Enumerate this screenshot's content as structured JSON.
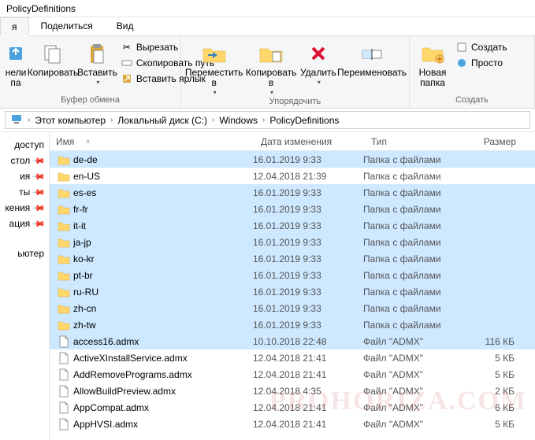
{
  "title": "PolicyDefinitions",
  "tabs": {
    "home": "я",
    "share": "Поделиться",
    "view": "Вид"
  },
  "ribbon": {
    "pin_label": "нели\nпа",
    "copy": "Копировать",
    "paste": "Вставить",
    "cut": "Вырезать",
    "copypath": "Скопировать путь",
    "pastelnk": "Вставить ярлык",
    "clipboard_group": "Буфер обмена",
    "moveto": "Переместить\nв",
    "copyto": "Копировать\nв",
    "delete": "Удалить",
    "rename": "Переименовать",
    "organize_group": "Упорядочить",
    "newfolder": "Новая\nпапка",
    "create": "Создать",
    "create_group": "Создать",
    "simple": "Просто"
  },
  "breadcrumbs": [
    "Этот компьютер",
    "Локальный диск (C:)",
    "Windows",
    "PolicyDefinitions"
  ],
  "sidebar": {
    "access": "доступ",
    "items": [
      "стол",
      "ия",
      "ты",
      "кения",
      "ация"
    ],
    "computer": "ьютер"
  },
  "columns": {
    "name": "Имя",
    "date": "Дата изменения",
    "type": "Тип",
    "size": "Размер"
  },
  "type_folder": "Папка с файлами",
  "type_admx": "Файл \"ADMX\"",
  "rows": [
    {
      "n": "de-de",
      "d": "16.01.2019 9:33",
      "t": "folder",
      "s": "",
      "sel": true
    },
    {
      "n": "en-US",
      "d": "12.04.2018 21:39",
      "t": "folder",
      "s": "",
      "sel": false
    },
    {
      "n": "es-es",
      "d": "16.01.2019 9:33",
      "t": "folder",
      "s": "",
      "sel": true
    },
    {
      "n": "fr-fr",
      "d": "16.01.2019 9:33",
      "t": "folder",
      "s": "",
      "sel": true
    },
    {
      "n": "it-it",
      "d": "16.01.2019 9:33",
      "t": "folder",
      "s": "",
      "sel": true
    },
    {
      "n": "ja-jp",
      "d": "16.01.2019 9:33",
      "t": "folder",
      "s": "",
      "sel": true
    },
    {
      "n": "ko-kr",
      "d": "16.01.2019 9:33",
      "t": "folder",
      "s": "",
      "sel": true
    },
    {
      "n": "pt-br",
      "d": "16.01.2019 9:33",
      "t": "folder",
      "s": "",
      "sel": true
    },
    {
      "n": "ru-RU",
      "d": "16.01.2019 9:33",
      "t": "folder",
      "s": "",
      "sel": true
    },
    {
      "n": "zh-cn",
      "d": "16.01.2019 9:33",
      "t": "folder",
      "s": "",
      "sel": true
    },
    {
      "n": "zh-tw",
      "d": "16.01.2019 9:33",
      "t": "folder",
      "s": "",
      "sel": true
    },
    {
      "n": "access16.admx",
      "d": "10.10.2018 22:48",
      "t": "admx",
      "s": "116 КБ",
      "sel": true
    },
    {
      "n": "ActiveXInstallService.admx",
      "d": "12.04.2018 21:41",
      "t": "admx",
      "s": "5 КБ",
      "sel": false
    },
    {
      "n": "AddRemovePrograms.admx",
      "d": "12.04.2018 21:41",
      "t": "admx",
      "s": "5 КБ",
      "sel": false
    },
    {
      "n": "AllowBuildPreview.admx",
      "d": "12.04.2018 4:35",
      "t": "admx",
      "s": "2 КБ",
      "sel": false
    },
    {
      "n": "AppCompat.admx",
      "d": "12.04.2018 21:41",
      "t": "admx",
      "s": "6 КБ",
      "sel": false
    },
    {
      "n": "AppHVSI.admx",
      "d": "12.04.2018 21:41",
      "t": "admx",
      "s": "5 КБ",
      "sel": false
    }
  ],
  "watermark": "PROHORIZA.COM"
}
